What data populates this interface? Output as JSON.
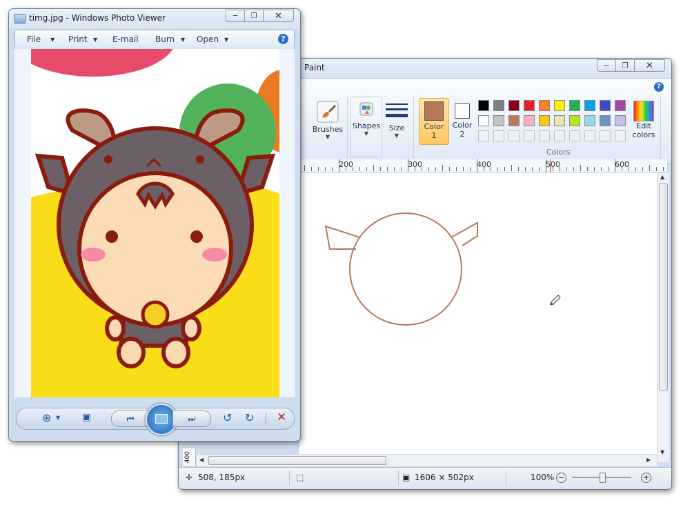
{
  "paint": {
    "title": "Paint",
    "ribbon": {
      "brushes": "Brushes",
      "shapes": "Shapes",
      "size": "Size",
      "color1": "Color\n1",
      "color1_line1": "Color",
      "color1_line2": "1",
      "color2_line1": "Color",
      "color2_line2": "2",
      "edit_colors_line1": "Edit",
      "edit_colors_line2": "colors",
      "colors_group": "Colors",
      "color1_value": "#b9785a",
      "color2_value": "#ffffff",
      "palette_row1": [
        "#000000",
        "#7f7f7f",
        "#880015",
        "#ed1c24",
        "#ff7f27",
        "#fff200",
        "#22b14c",
        "#00a2e8",
        "#3f48cc",
        "#a349a4"
      ],
      "palette_row2": [
        "#ffffff",
        "#c3c3c3",
        "#b97a57",
        "#ffaec9",
        "#ffc90e",
        "#efe4b0",
        "#b5e61d",
        "#99d9ea",
        "#7092be",
        "#c8bfe7"
      ]
    },
    "ruler": [
      "200",
      "300",
      "400",
      "500",
      "600"
    ],
    "vruler_label": "400",
    "status": {
      "cursor_pos": "508, 185px",
      "canvas_size": "1606 × 502px",
      "zoom": "100%"
    }
  },
  "viewer": {
    "title": "timg.jpg - Windows Photo Viewer",
    "menu": {
      "file": "File",
      "print": "Print",
      "email": "E-mail",
      "burn": "Burn",
      "open": "Open"
    }
  }
}
